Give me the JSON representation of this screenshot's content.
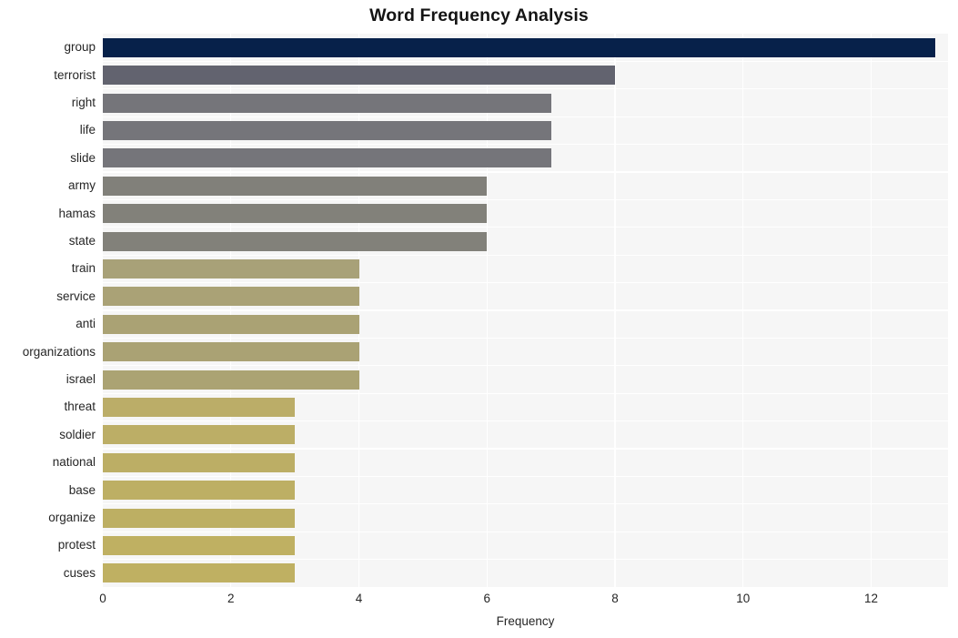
{
  "chart_data": {
    "type": "bar",
    "orientation": "horizontal",
    "title": "Word Frequency Analysis",
    "xlabel": "Frequency",
    "ylabel": "",
    "xlim": [
      0,
      13.2
    ],
    "ylim": [
      0,
      20
    ],
    "grid": true,
    "legend": false,
    "xticks": [
      0,
      2,
      4,
      6,
      8,
      10,
      12
    ],
    "xtick_labels": [
      "0",
      "2",
      "4",
      "6",
      "8",
      "10",
      "12"
    ],
    "categories": [
      "group",
      "terrorist",
      "right",
      "life",
      "slide",
      "army",
      "hamas",
      "state",
      "train",
      "service",
      "anti",
      "organizations",
      "israel",
      "threat",
      "soldier",
      "national",
      "base",
      "organize",
      "protest",
      "cuses"
    ],
    "values": [
      13,
      8,
      7,
      7,
      7,
      6,
      6,
      6,
      4,
      4,
      4,
      4,
      4,
      3,
      3,
      3,
      3,
      3,
      3,
      3
    ],
    "bar_colors": [
      "#07214a",
      "#62636f",
      "#75757a",
      "#75757a",
      "#75757a",
      "#81807a",
      "#82817a",
      "#82817a",
      "#a8a178",
      "#aaa276",
      "#aaa274",
      "#aaa274",
      "#aba373",
      "#bbad68",
      "#bcae66",
      "#bcae65",
      "#bdaf64",
      "#bdaf63",
      "#bfb062",
      "#bfb062"
    ],
    "plot_background": "#f6f6f6",
    "grid_color": "#ffffff",
    "text_color": "#262626",
    "title_color": "#141414"
  }
}
